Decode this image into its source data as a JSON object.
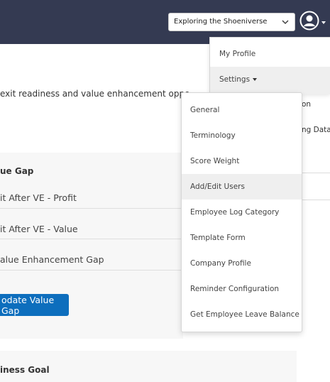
{
  "navbar": {
    "company_select_value": "Exploring the Shoeniverse",
    "colors": {
      "navbar_bg": "#343a52",
      "primary": "#0d6ebd"
    }
  },
  "main": {
    "intro_text": "exit readiness and value enhancement oppo",
    "value_gap_card": {
      "title": "ue Gap",
      "rows": [
        "it After VE - Profit",
        "it After VE - Value",
        "alue Enhancement Gap"
      ],
      "update_button": "odate Value Gap"
    },
    "business_goal_card": {
      "title": "iness Goal"
    },
    "peek_text_1": "on",
    "peek_text_2": "ng Data"
  },
  "profile_menu": {
    "items": [
      {
        "label": "My Profile"
      },
      {
        "label": "Settings"
      }
    ]
  },
  "settings_menu": {
    "items": [
      {
        "label": "General"
      },
      {
        "label": "Terminology"
      },
      {
        "label": "Score Weight"
      },
      {
        "label": "Add/Edit Users"
      },
      {
        "label": "Employee Log Category"
      },
      {
        "label": "Template Form"
      },
      {
        "label": "Company Profile"
      },
      {
        "label": "Reminder Configuration"
      },
      {
        "label": "Get Employee Leave Balance"
      }
    ]
  }
}
